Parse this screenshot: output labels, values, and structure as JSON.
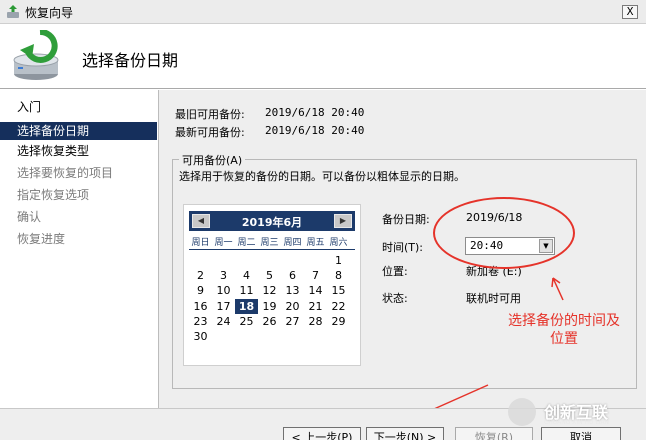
{
  "window": {
    "title": "恢复向导",
    "close_glyph": "X"
  },
  "header": {
    "title": "选择备份日期",
    "icon": "restore-disk-icon"
  },
  "sidebar": {
    "items": [
      {
        "label": "入门",
        "state": "normal"
      },
      {
        "label": "选择备份日期",
        "state": "selected"
      },
      {
        "label": "选择恢复类型",
        "state": "normal"
      },
      {
        "label": "选择要恢复的项目",
        "state": "disabled"
      },
      {
        "label": "指定恢复选项",
        "state": "disabled"
      },
      {
        "label": "确认",
        "state": "disabled"
      },
      {
        "label": "恢复进度",
        "state": "disabled"
      }
    ]
  },
  "info": {
    "oldest_label": "最旧可用备份:",
    "oldest_value": "2019/6/18 20:40",
    "newest_label": "最新可用备份:",
    "newest_value": "2019/6/18 20:40"
  },
  "group": {
    "legend": "可用备份(A)",
    "description": "选择用于恢复的备份的日期。可以备份以粗体显示的日期。"
  },
  "calendar": {
    "month_label": "2019年6月",
    "prev_glyph": "◀",
    "next_glyph": "▶",
    "weekdays": [
      "周日",
      "周一",
      "周二",
      "周三",
      "周四",
      "周五",
      "周六"
    ],
    "first_weekday_index": 6,
    "days_in_month": 30,
    "selected_day": 18
  },
  "details": {
    "date_label": "备份日期:",
    "date_value": "2019/6/18",
    "time_label": "时间(T):",
    "time_value": "20:40",
    "location_label": "位置:",
    "location_value": "新加卷 (E:)",
    "status_label": "状态:",
    "status_value": "联机时可用"
  },
  "annotation": {
    "text": "选择备份的时间及位置",
    "color": "#e5332a"
  },
  "buttons": {
    "prev": "< 上一步(P)",
    "next": "下一步(N) >",
    "restore": "恢复(R)",
    "cancel": "取消"
  },
  "watermark": {
    "name": "创新互联",
    "sub": "CHUANG XIN HU LIAN"
  },
  "colors": {
    "selection": "#152f5c",
    "calendar_header": "#1c3a6a"
  }
}
